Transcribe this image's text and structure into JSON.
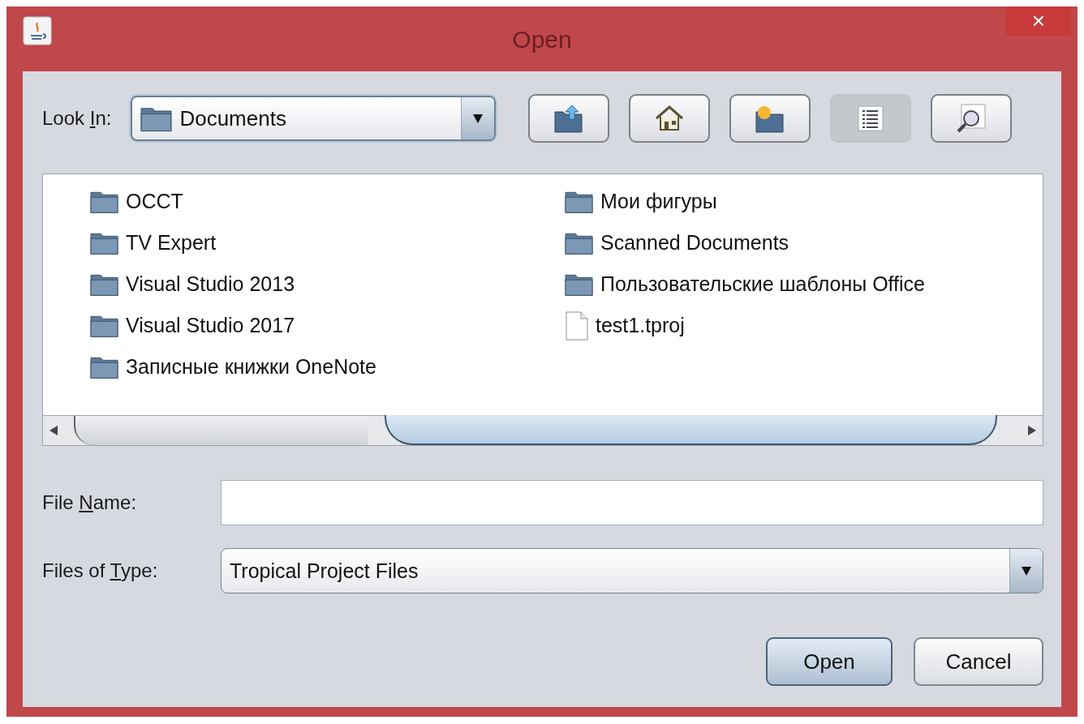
{
  "window": {
    "title": "Open",
    "close": "×"
  },
  "look_in": {
    "label": [
      {
        "text": "Look ",
        "underlined": false
      },
      {
        "text": "I",
        "underlined": true
      },
      {
        "text": "n:",
        "underlined": false
      }
    ],
    "value": "Documents"
  },
  "toolbar": [
    {
      "kind": "up",
      "selected": false
    },
    {
      "kind": "home",
      "selected": false
    },
    {
      "kind": "new-folder",
      "selected": false
    },
    {
      "kind": "list",
      "selected": true
    },
    {
      "kind": "details",
      "selected": false
    }
  ],
  "files": [
    {
      "name": "OCCT",
      "kind": "folder"
    },
    {
      "name": "TV Expert",
      "kind": "folder"
    },
    {
      "name": "Visual Studio 2013",
      "kind": "folder"
    },
    {
      "name": "Visual Studio 2017",
      "kind": "folder"
    },
    {
      "name": "Записные книжки OneNote",
      "kind": "folder"
    },
    {
      "name": "Мои фигуры",
      "kind": "folder"
    },
    {
      "name": "Scanned Documents",
      "kind": "folder"
    },
    {
      "name": "Пользовательские шаблоны Office",
      "kind": "folder"
    },
    {
      "name": "test1.tproj",
      "kind": "file"
    }
  ],
  "file_name": {
    "label": [
      {
        "text": "File ",
        "underlined": false
      },
      {
        "text": "N",
        "underlined": true
      },
      {
        "text": "ame:",
        "underlined": false
      }
    ]
  },
  "files_of_type": {
    "label": [
      {
        "text": "Files of ",
        "underlined": false
      },
      {
        "text": "T",
        "underlined": true
      },
      {
        "text": "ype:",
        "underlined": false
      }
    ],
    "value": "Tropical Project Files"
  },
  "buttons": [
    {
      "label": "Open",
      "default": true
    },
    {
      "label": "Cancel",
      "default": false
    }
  ]
}
